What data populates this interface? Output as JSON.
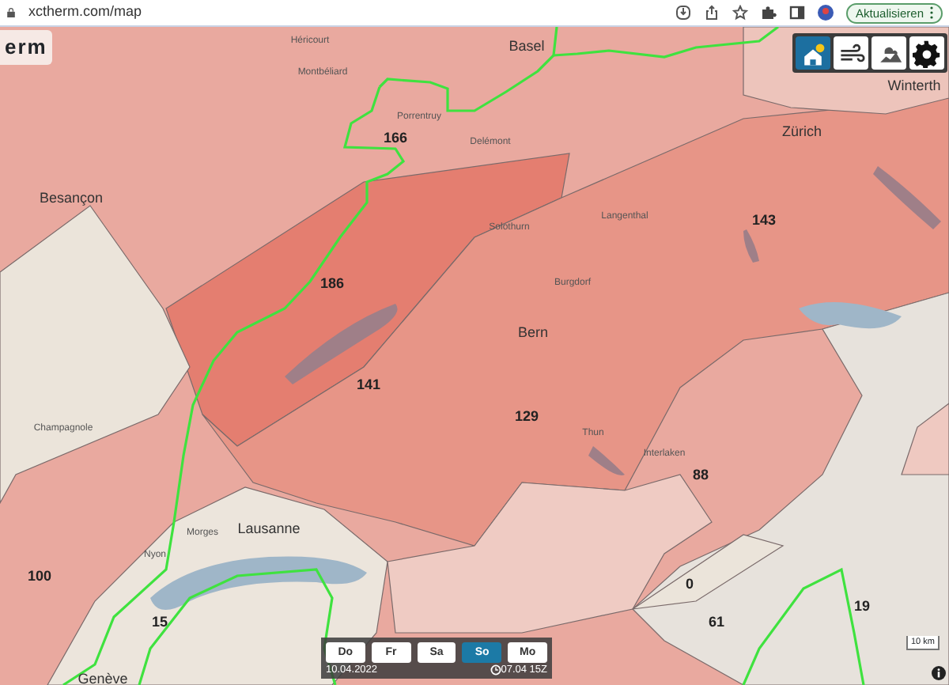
{
  "browser": {
    "url": "xctherm.com/map",
    "update_button": "Aktualisieren"
  },
  "app": {
    "title": "erm"
  },
  "layer_buttons": [
    {
      "kind": "thermal",
      "selected": true
    },
    {
      "kind": "wind",
      "selected": false
    },
    {
      "kind": "cloud",
      "selected": false
    }
  ],
  "map": {
    "region_values": [
      "166",
      "186",
      "141",
      "129",
      "143",
      "88",
      "100",
      "15",
      "0",
      "61",
      "19"
    ],
    "places": [
      {
        "name": "Basel",
        "kind": "city"
      },
      {
        "name": "Zürich",
        "kind": "city"
      },
      {
        "name": "Winterth",
        "kind": "city"
      },
      {
        "name": "Besançon",
        "kind": "city"
      },
      {
        "name": "Bern",
        "kind": "city"
      },
      {
        "name": "Lausanne",
        "kind": "city"
      },
      {
        "name": "Genève",
        "kind": "city"
      },
      {
        "name": "Héricourt",
        "kind": "town"
      },
      {
        "name": "Montbéliard",
        "kind": "town"
      },
      {
        "name": "Porrentruy",
        "kind": "town"
      },
      {
        "name": "Delémont",
        "kind": "town"
      },
      {
        "name": "Solothurn",
        "kind": "town"
      },
      {
        "name": "Langenthal",
        "kind": "town"
      },
      {
        "name": "Burgdorf",
        "kind": "town"
      },
      {
        "name": "Thun",
        "kind": "town"
      },
      {
        "name": "Interlaken",
        "kind": "town"
      },
      {
        "name": "Champagnole",
        "kind": "town"
      },
      {
        "name": "Morges",
        "kind": "town"
      },
      {
        "name": "Nyon",
        "kind": "town"
      }
    ]
  },
  "day_selector": {
    "days": [
      {
        "label": "Do",
        "selected": false
      },
      {
        "label": "Fr",
        "selected": false
      },
      {
        "label": "Sa",
        "selected": false
      },
      {
        "label": "So",
        "selected": true
      },
      {
        "label": "Mo",
        "selected": false
      }
    ],
    "date": "10.04.2022",
    "run_time": "07.04 15Z"
  },
  "scale": "10 km"
}
